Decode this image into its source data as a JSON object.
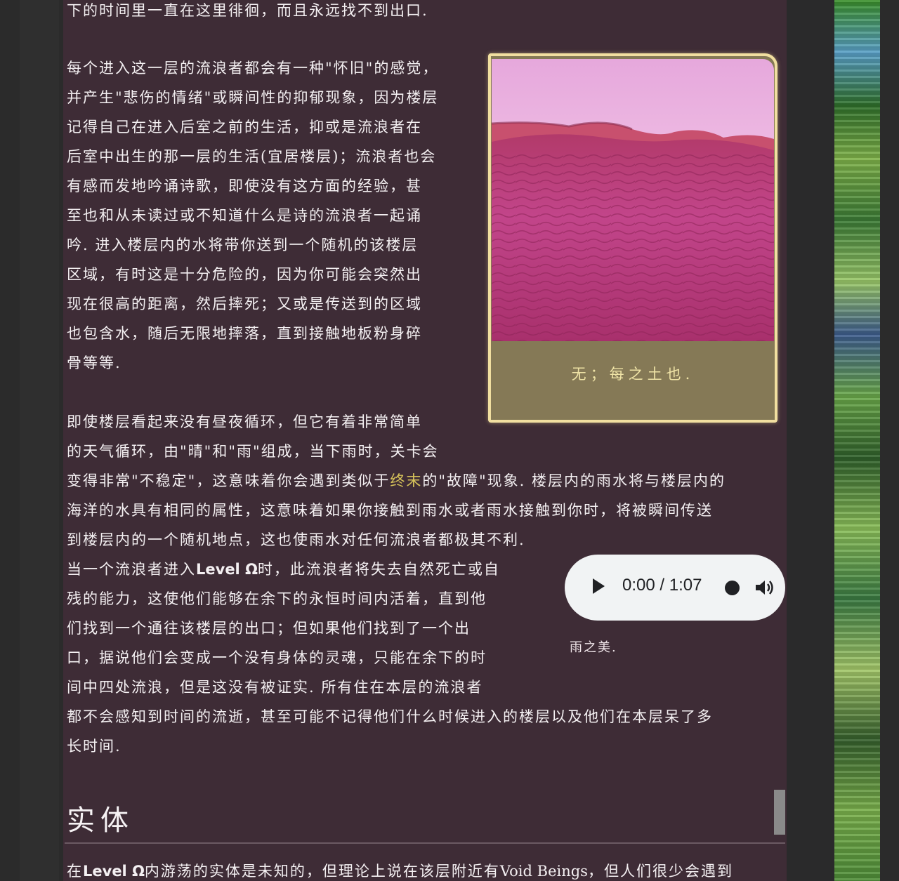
{
  "article": {
    "p0_line": "下的时间里一直在这里徘徊，而且永远找不到出口.",
    "p1_lines": [
      "每个进入这一层的流浪者都会有一种\"怀旧\"的感觉，",
      "并产生\"悲伤的情绪\"或瞬间性的抑郁现象，因为楼层",
      "记得自己在进入后室之前的生活，抑或是流浪者在",
      "后室中出生的那一层的生活(宜居楼层)；流浪者也会",
      "有感而发地吟诵诗歌，即使没有这方面的经验，甚",
      "至也和从未读过或不知道什么是诗的流浪者一起诵",
      "吟. 进入楼层内的水将带你送到一个随机的该楼层",
      "区域，有时这是十分危险的，因为你可能会突然出",
      "现在很高的距离，然后摔死；又或是传送到的区域",
      "也包含水，随后无限地摔落，直到接触地板粉身碎",
      "骨等等."
    ],
    "p2_line1": "即使楼层看起来没有昼夜循环，但它有着非常简单",
    "p2_line2": "的天气循环，由\"晴\"和\"雨\"组成，当下雨时，关卡会",
    "p2_line3_pre": "变得非常\"不稳定\"，这意味着你会遇到类似于",
    "p2_link": "终末",
    "p2_line3_post": "的\"故障\"现象. 楼层内的雨水将与楼层内的",
    "p2_line4": "海洋的水具有相同的属性，这意味着如果你接触到雨水或者雨水接触到你时，将被瞬间传送",
    "p2_line5": "到楼层内的一个随机地点，这也使雨水对任何流浪者都极其不利.",
    "p3_line1_pre": "当一个流浪者进入",
    "p3_level": "Level Ω",
    "p3_line1_post": "时，此流浪者将失去自然死亡或自",
    "p3_lines": [
      "残的能力，这使他们能够在余下的永恒时间内活着，直到他",
      "们找到一个通往该楼层的出口；但如果他们找到了一个出",
      "口，据说他们会变成一个没有身体的灵魂，只能在余下的时",
      "间中四处流浪，但是这没有被证实. 所有住在本层的流浪者",
      "都不会感知到时间的流逝，甚至可能不记得他们什么时候进入的楼层以及他们在本层呆了多",
      "长时间."
    ],
    "section_title": "实体",
    "p4_pre": "在",
    "p4_level": "Level Ω",
    "p4_mid": "内游荡的实体是未知的，但理论上说在该层附近有",
    "p4_void": "Void Beings",
    "p4_post": "，但人们很少会遇到"
  },
  "figure": {
    "caption": "无；每之土也."
  },
  "audio": {
    "time": "0:00 / 1:07",
    "caption": "雨之美."
  },
  "colors": {
    "background": "#3e2c36",
    "link": "#d6c25a",
    "figure_border": "#f1dfa0",
    "caption_bg": "#857956"
  },
  "icons": [
    "play-icon",
    "record-icon",
    "volume-icon"
  ]
}
